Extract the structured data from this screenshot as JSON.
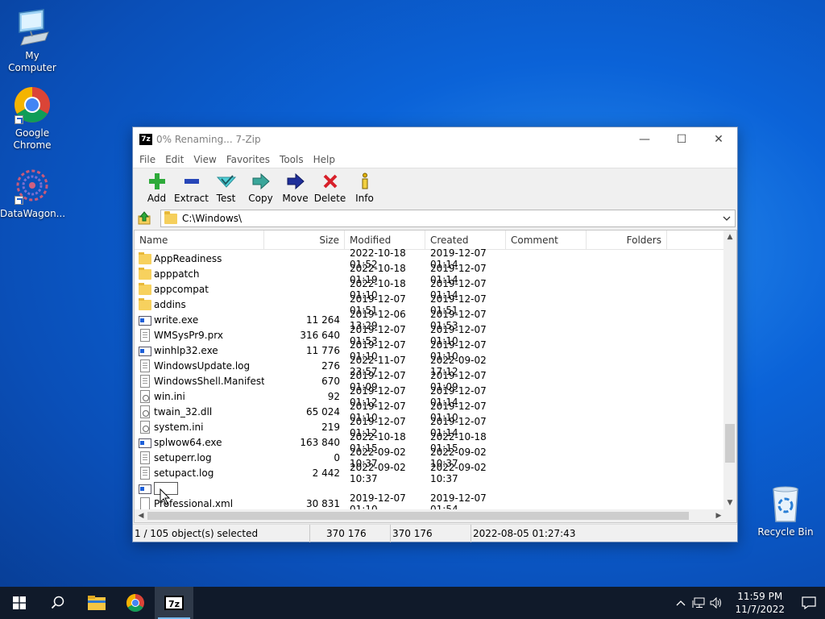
{
  "desktop": {
    "icons": [
      {
        "label": "My Computer",
        "icon": "monitor-icon"
      },
      {
        "label": "Google Chrome",
        "icon": "chrome-icon"
      },
      {
        "label": "DataWagon...",
        "icon": "datawagon-icon"
      }
    ],
    "recycle_bin": {
      "label": "Recycle Bin",
      "icon": "recycle-bin-icon"
    }
  },
  "window": {
    "title": "0% Renaming... 7-Zip",
    "app_logo": "7z",
    "controls": {
      "minimize": "—",
      "maximize": "☐",
      "close": "✕"
    },
    "menu": [
      "File",
      "Edit",
      "View",
      "Favorites",
      "Tools",
      "Help"
    ],
    "toolbar": [
      {
        "label": "Add",
        "icon": "add-icon"
      },
      {
        "label": "Extract",
        "icon": "extract-icon"
      },
      {
        "label": "Test",
        "icon": "test-icon"
      },
      {
        "label": "Copy",
        "icon": "copy-icon"
      },
      {
        "label": "Move",
        "icon": "move-icon"
      },
      {
        "label": "Delete",
        "icon": "delete-icon"
      },
      {
        "label": "Info",
        "icon": "info-icon"
      }
    ],
    "address": "C:\\Windows\\",
    "columns": [
      "Name",
      "Size",
      "Modified",
      "Created",
      "Comment",
      "Folders"
    ],
    "rows": [
      {
        "type": "folder",
        "name": "AppReadiness",
        "size": "",
        "modified": "2022-10-18 01:52",
        "created": "2019-12-07 01:14"
      },
      {
        "type": "folder",
        "name": "apppatch",
        "size": "",
        "modified": "2022-10-18 01:19",
        "created": "2019-12-07 01:14"
      },
      {
        "type": "folder",
        "name": "appcompat",
        "size": "",
        "modified": "2022-10-18 01:10",
        "created": "2019-12-07 01:14"
      },
      {
        "type": "folder",
        "name": "addins",
        "size": "",
        "modified": "2019-12-07 01:51",
        "created": "2019-12-07 01:51"
      },
      {
        "type": "exe",
        "name": "write.exe",
        "size": "11 264",
        "modified": "2019-12-06 13:29",
        "created": "2019-12-07 01:53"
      },
      {
        "type": "doc",
        "name": "WMSysPr9.prx",
        "size": "316 640",
        "modified": "2019-12-07 01:53",
        "created": "2019-12-07 01:10"
      },
      {
        "type": "exe",
        "name": "winhlp32.exe",
        "size": "11 776",
        "modified": "2019-12-07 01:10",
        "created": "2019-12-07 01:10"
      },
      {
        "type": "doc",
        "name": "WindowsUpdate.log",
        "size": "276",
        "modified": "2022-11-07 23:57",
        "created": "2022-09-02 17:12"
      },
      {
        "type": "doc",
        "name": "WindowsShell.Manifest",
        "size": "670",
        "modified": "2019-12-07 01:09",
        "created": "2019-12-07 01:09"
      },
      {
        "type": "cfg",
        "name": "win.ini",
        "size": "92",
        "modified": "2019-12-07 01:12",
        "created": "2019-12-07 01:14"
      },
      {
        "type": "cfg",
        "name": "twain_32.dll",
        "size": "65 024",
        "modified": "2019-12-07 01:10",
        "created": "2019-12-07 01:10"
      },
      {
        "type": "cfg",
        "name": "system.ini",
        "size": "219",
        "modified": "2019-12-07 01:12",
        "created": "2019-12-07 01:14"
      },
      {
        "type": "exe",
        "name": "splwow64.exe",
        "size": "163 840",
        "modified": "2022-10-18 01:15",
        "created": "2022-10-18 01:15"
      },
      {
        "type": "doc",
        "name": "setuperr.log",
        "size": "0",
        "modified": "2022-09-02 10:37",
        "created": "2022-09-02 10:37"
      },
      {
        "type": "doc",
        "name": "setupact.log",
        "size": "2 442",
        "modified": "2022-09-02 10:37",
        "created": "2022-09-02 10:37"
      },
      {
        "type": "rename",
        "name": "",
        "size": "",
        "modified": "",
        "created": ""
      },
      {
        "type": "xml",
        "name": "Professional.xml",
        "size": "30 831",
        "modified": "2019-12-07 01:10",
        "created": "2019-12-07 01:54"
      }
    ],
    "status": {
      "selection": "1 / 105 object(s) selected",
      "size": "370 176",
      "packed": "370 176",
      "date": "2022-08-05 01:27:43"
    }
  },
  "taskbar": {
    "items": [
      {
        "name": "start",
        "icon": "windows-logo-icon"
      },
      {
        "name": "search",
        "icon": "search-icon"
      },
      {
        "name": "file-explorer",
        "icon": "folder-icon"
      },
      {
        "name": "chrome",
        "icon": "chrome-icon"
      },
      {
        "name": "7zip",
        "icon": "7zip-icon",
        "label": "7z"
      }
    ],
    "clock_time": "11:59 PM",
    "clock_date": "11/7/2022"
  },
  "colors": {
    "accent": "#1e5fd8",
    "folder": "#f7d15e",
    "taskbar": "#101a2a"
  }
}
